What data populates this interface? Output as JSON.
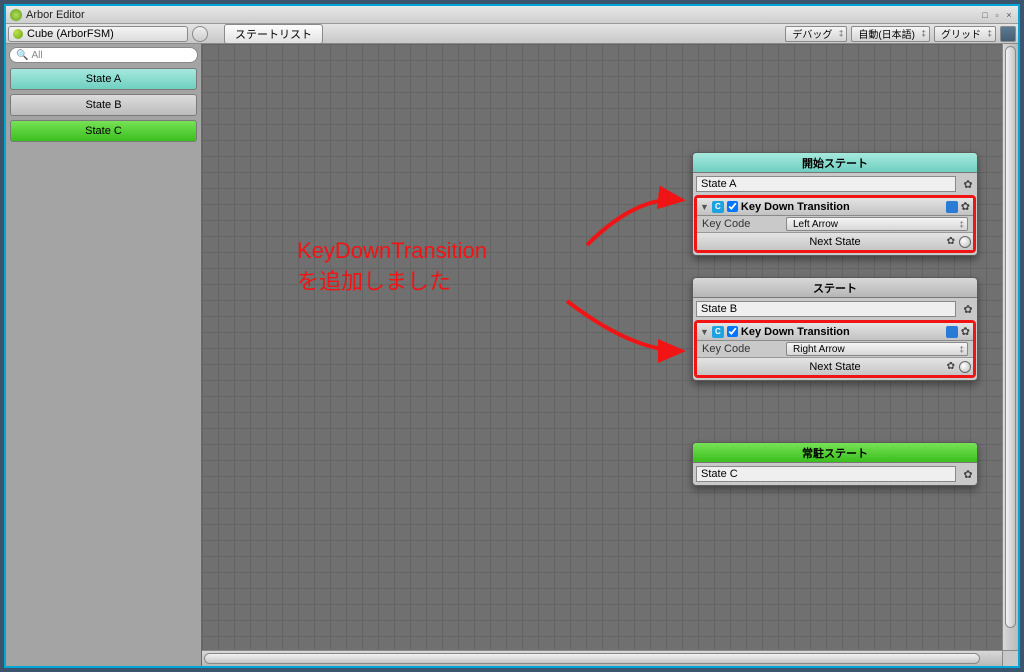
{
  "window": {
    "title": "Arbor Editor"
  },
  "toolbar": {
    "object": "Cube (ArborFSM)",
    "tab": "ステートリスト",
    "debug": "デバッグ",
    "lang": "自動(日本語)",
    "grid": "グリッド"
  },
  "search": {
    "icon": "🔍",
    "placeholder": "All"
  },
  "sidebar": {
    "items": [
      {
        "label": "State A",
        "kind": "start"
      },
      {
        "label": "State B",
        "kind": "norm"
      },
      {
        "label": "State C",
        "kind": "res"
      }
    ]
  },
  "nodes": {
    "a": {
      "header": "開始ステート",
      "name": "State A",
      "behaviour": {
        "title": "Key Down Transition",
        "field": "Key Code",
        "value": "Left Arrow",
        "next": "Next State"
      }
    },
    "b": {
      "header": "ステート",
      "name": "State B",
      "behaviour": {
        "title": "Key Down Transition",
        "field": "Key Code",
        "value": "Right Arrow",
        "next": "Next State"
      }
    },
    "c": {
      "header": "常駐ステート",
      "name": "State C"
    }
  },
  "annotation": {
    "line1": "KeyDownTransition",
    "line2": "を追加しました"
  }
}
